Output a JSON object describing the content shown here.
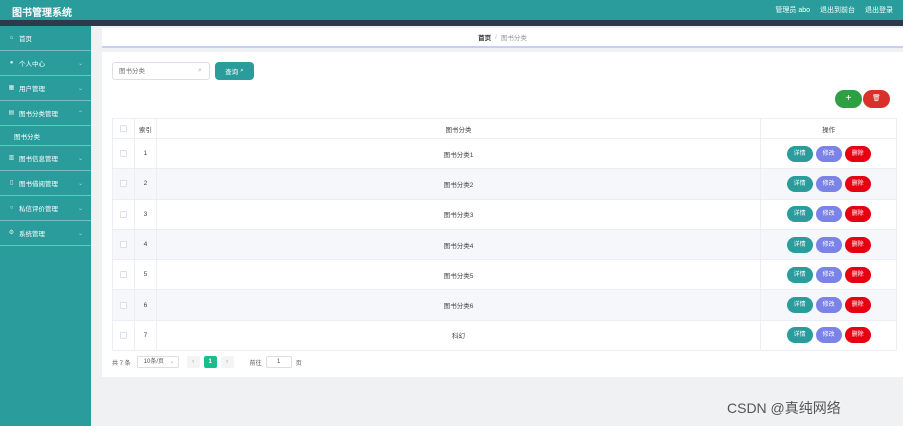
{
  "header": {
    "app_title": "图书管理系统",
    "user": "管理员 abo",
    "back_to_front": "退出到前台",
    "logout": "退出登录"
  },
  "sidebar": {
    "items": [
      {
        "label": "首页",
        "icon": "home-icon"
      },
      {
        "label": "个人中心",
        "icon": "user-icon"
      },
      {
        "label": "用户管理",
        "icon": "users-icon"
      },
      {
        "label": "图书分类管理",
        "icon": "category-icon"
      },
      {
        "label": "图书分类",
        "icon": ""
      },
      {
        "label": "图书信息管理",
        "icon": "book-icon"
      },
      {
        "label": "图书借阅管理",
        "icon": "borrow-icon"
      },
      {
        "label": "私信评价管理",
        "icon": "message-icon"
      },
      {
        "label": "系统管理",
        "icon": "gear-icon"
      }
    ]
  },
  "breadcrumb": {
    "home": "首页",
    "separator": "/",
    "current": "图书分类"
  },
  "search": {
    "placeholder": "图书分类",
    "button_label": "查询"
  },
  "actions": {
    "add": "+",
    "delete_icon": "🗑"
  },
  "table": {
    "columns": [
      "索引",
      "图书分类",
      "操作"
    ],
    "rows": [
      {
        "index": "1",
        "name": "图书分类1"
      },
      {
        "index": "2",
        "name": "图书分类2"
      },
      {
        "index": "3",
        "name": "图书分类3"
      },
      {
        "index": "4",
        "name": "图书分类4"
      },
      {
        "index": "5",
        "name": "图书分类5"
      },
      {
        "index": "6",
        "name": "图书分类6"
      },
      {
        "index": "7",
        "name": "科幻"
      }
    ],
    "op_labels": {
      "detail": "详情",
      "edit": "修改",
      "remove": "删除"
    }
  },
  "pagination": {
    "total": "共 7 条",
    "page_size": "10条/页",
    "prev": "‹",
    "current_page": "1",
    "next": "›",
    "goto_label": "前往",
    "goto_value": "1",
    "page_unit": "页"
  },
  "watermark": "CSDN @真纯网络",
  "colors": {
    "primary": "#2a9c9c",
    "dark_strip": "#2d3a4b",
    "add": "#2ea043",
    "danger": "#d9302c",
    "edit": "#7b83e8",
    "remove": "#e60012"
  }
}
